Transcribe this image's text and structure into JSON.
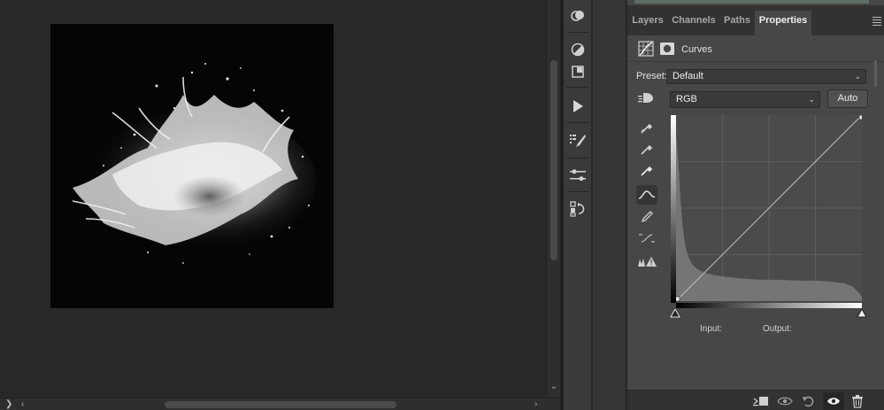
{
  "panel": {
    "tabs": [
      {
        "label": "Layers",
        "active": false
      },
      {
        "label": "Channels",
        "active": false
      },
      {
        "label": "Paths",
        "active": false
      },
      {
        "label": "Properties",
        "active": true
      }
    ],
    "header_title": "Curves",
    "preset_label": "Preset:",
    "preset_value": "Default",
    "channel_value": "RGB",
    "auto_label": "Auto",
    "input_label": "Input:",
    "output_label": "Output:"
  },
  "canvas": {
    "image_description_icon": "powder-explosion-image"
  },
  "tool_column_icons": [
    "adjustments-icon",
    "color-half-icon",
    "swatch-icon",
    "play-icon",
    "brush-settings-icon",
    "properties-sliders-icon",
    "history-icon"
  ],
  "curve_side_tools": [
    "target-adjust-icon",
    "black-point-eyedropper-icon",
    "gray-point-eyedropper-icon",
    "white-point-eyedropper-icon",
    "curve-points-icon",
    "pencil-icon",
    "smooth-icon",
    "clipping-warning-icon"
  ],
  "bottom_icons": [
    "clip-to-layer-icon",
    "view-previous-icon",
    "reset-icon",
    "visibility-icon",
    "delete-icon"
  ],
  "colors": {
    "panel_bg": "#474747",
    "tab_bar": "#323232",
    "canvas_bg": "#282828",
    "graph_bg": "#4b4b4b"
  }
}
